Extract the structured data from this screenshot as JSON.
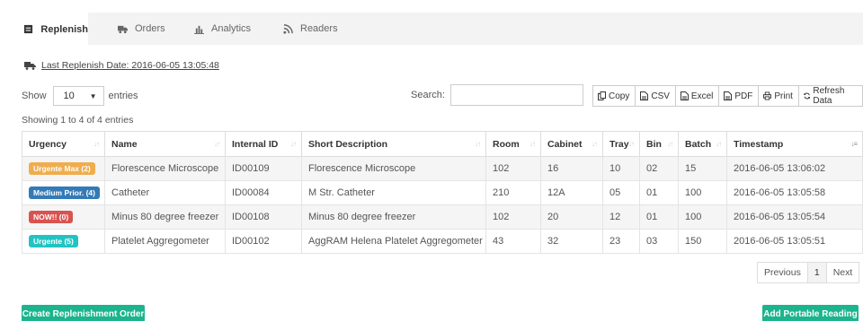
{
  "tabs": [
    {
      "label": "Replenish",
      "icon": "clipboard-icon",
      "active": true
    },
    {
      "label": "Orders",
      "icon": "truck-icon",
      "active": false
    },
    {
      "label": "Analytics",
      "icon": "bar-chart-icon",
      "active": false
    },
    {
      "label": "Readers",
      "icon": "rss-icon",
      "active": false
    }
  ],
  "last_replenish": "Last Replenish Date: 2016-06-05 13:05:48",
  "length": {
    "show_label": "Show",
    "value": "10",
    "entries_label": "entries"
  },
  "search": {
    "label": "Search:",
    "value": ""
  },
  "buttons": [
    {
      "label": "Copy",
      "icon": "copy-icon"
    },
    {
      "label": "CSV",
      "icon": "file-icon"
    },
    {
      "label": "Excel",
      "icon": "file-icon"
    },
    {
      "label": "PDF",
      "icon": "file-icon"
    },
    {
      "label": "Print",
      "icon": "print-icon"
    },
    {
      "label": "Refresh Data",
      "icon": "refresh-icon"
    }
  ],
  "info": "Showing 1 to 4 of 4 entries",
  "table": {
    "headers": [
      "Urgency",
      "Name",
      "Internal ID",
      "Short Description",
      "Room",
      "Cabinet",
      "Tray",
      "Bin",
      "Batch",
      "Timestamp"
    ],
    "rows": [
      {
        "urgency": "Urgente Max (2)",
        "urgency_color": "#f0ad4e",
        "name": "Florescence Microscope",
        "id": "ID00109",
        "desc": "Florescence Microscope",
        "room": "102",
        "cabinet": "16",
        "tray": "10",
        "bin": "02",
        "batch": "15",
        "timestamp": "2016-06-05 13:06:02"
      },
      {
        "urgency": "Medium Prior. (4)",
        "urgency_color": "#337ab7",
        "name": "Catheter",
        "id": "ID00084",
        "desc": "M Str. Catheter",
        "room": "210",
        "cabinet": "12A",
        "tray": "05",
        "bin": "01",
        "batch": "100",
        "timestamp": "2016-06-05 13:05:58"
      },
      {
        "urgency": "NOW!! (0)",
        "urgency_color": "#d9534f",
        "name": "Minus 80 degree freezer",
        "id": "ID00108",
        "desc": "Minus 80 degree freezer",
        "room": "102",
        "cabinet": "20",
        "tray": "12",
        "bin": "01",
        "batch": "100",
        "timestamp": "2016-06-05 13:05:54"
      },
      {
        "urgency": "Urgente (5)",
        "urgency_color": "#22c3c3",
        "name": "Platelet Aggregometer",
        "id": "ID00102",
        "desc": "AggRAM Helena Platelet Aggregometer",
        "room": "43",
        "cabinet": "32",
        "tray": "23",
        "bin": "03",
        "batch": "150",
        "timestamp": "2016-06-05 13:05:51"
      }
    ]
  },
  "pagination": {
    "previous": "Previous",
    "page": "1",
    "next": "Next"
  },
  "actions": {
    "create": "Create Replenishment Order",
    "add": "Add Portable Reading",
    "color": "#1bb48d"
  }
}
